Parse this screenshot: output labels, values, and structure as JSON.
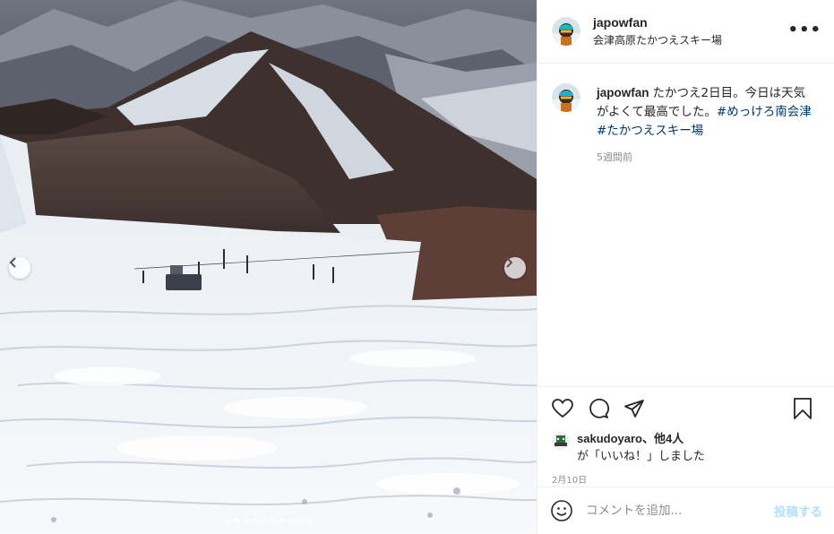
{
  "post": {
    "username": "japowfan",
    "location": "会津高原たかつえスキー場",
    "more_icon": "more-horizontal-icon",
    "caption_text": "たかつえ2日目。今日は天気がよくて最高でした。",
    "hashtags": [
      "#めっけろ南会津",
      "#たかつえスキー場"
    ],
    "time_ago": "5週間前",
    "liked_by_user": "sakudoyaro",
    "liked_by_others": "、他4人",
    "liked_suffix": "が「いいね！」しました",
    "date": "2月10日",
    "comment_placeholder": "コメントを追加...",
    "post_label": "投稿する"
  },
  "carousel": {
    "total_slides": 10,
    "active_slide": 2,
    "prev_icon": "chevron-left-icon",
    "next_icon": "chevron-right-icon"
  },
  "actions": {
    "like_icon": "heart-icon",
    "comment_icon": "comment-icon",
    "share_icon": "share-icon",
    "save_icon": "bookmark-icon"
  },
  "colors": {
    "hashtag": "#00376b",
    "post_button_disabled": "#b2dffc",
    "muted": "#8e8e8e",
    "border": "#efefef"
  }
}
